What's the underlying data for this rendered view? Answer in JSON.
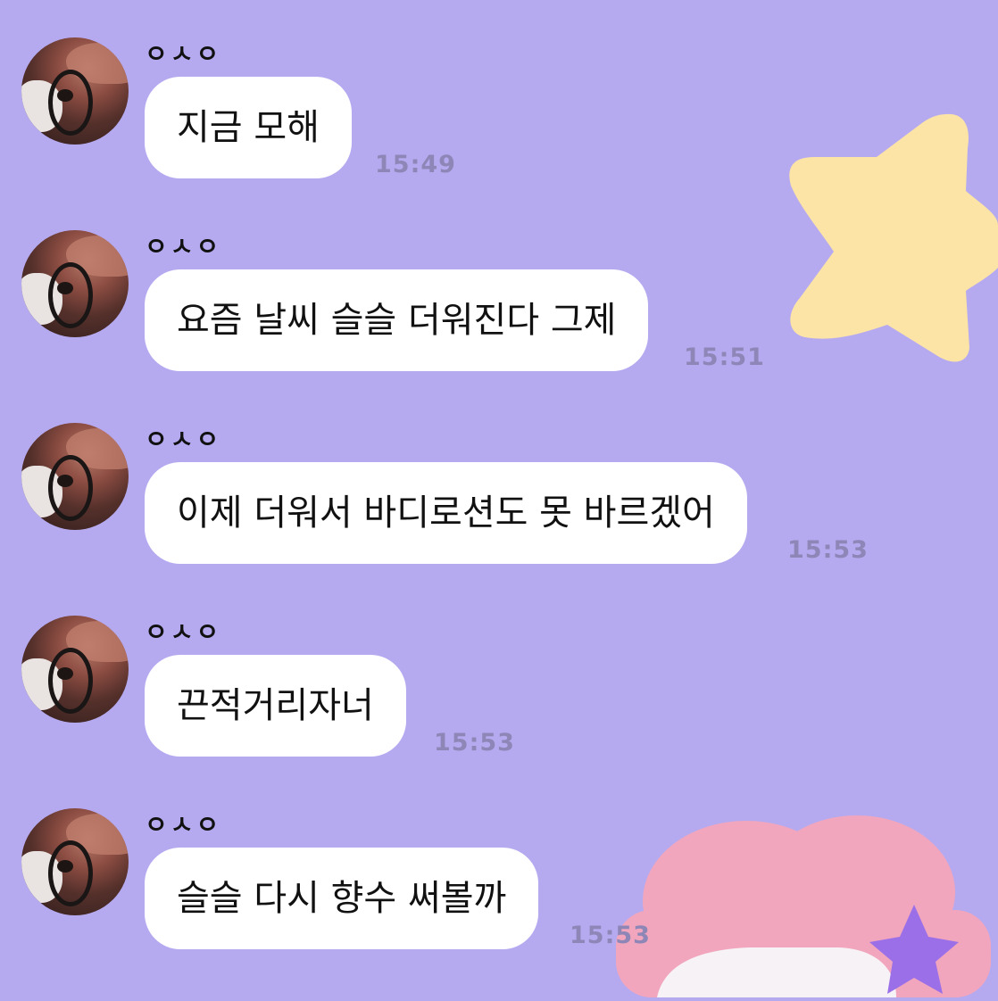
{
  "sender": "ㅇㅅㅇ",
  "messages": [
    {
      "text": "지금 모해",
      "time": "15:49"
    },
    {
      "text": "요즘 날씨 슬슬 더워진다 그제",
      "time": "15:51"
    },
    {
      "text": "이제 더워서 바디로션도 못 바르겠어",
      "time": "15:53"
    },
    {
      "text": "끈적거리자너",
      "time": "15:53"
    },
    {
      "text": "슬슬 다시 향수 써볼까",
      "time": "15:53"
    }
  ],
  "colors": {
    "background": "#b5aaf0",
    "bubble": "#ffffff",
    "time_text": "#8e86b6",
    "star_yellow": "#fce3a6",
    "character_pink": "#f1a6bd",
    "star_purple": "#9b6fe8"
  },
  "icons": [
    "avatar-image",
    "star-decoration-icon",
    "character-decoration"
  ]
}
